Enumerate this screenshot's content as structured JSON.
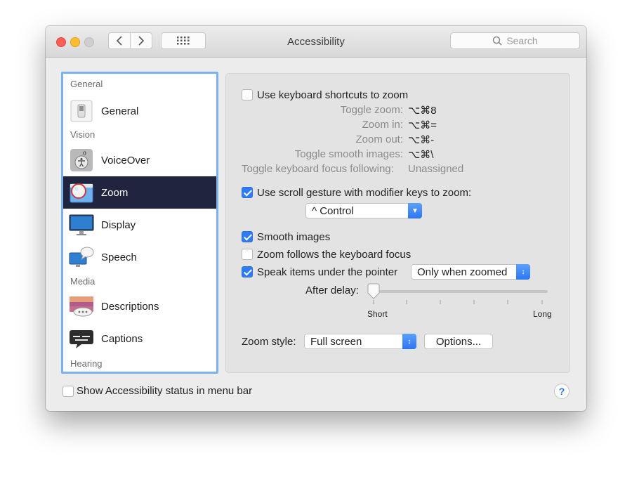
{
  "window": {
    "title": "Accessibility"
  },
  "toolbar": {
    "search_placeholder": "Search"
  },
  "sidebar": {
    "categories": [
      "General",
      "Vision",
      "Media",
      "Hearing"
    ],
    "items": [
      {
        "label": "General",
        "icon": "switch-icon"
      },
      {
        "label": "VoiceOver",
        "icon": "voiceover-icon"
      },
      {
        "label": "Zoom",
        "icon": "zoom-icon",
        "selected": true
      },
      {
        "label": "Display",
        "icon": "display-icon"
      },
      {
        "label": "Speech",
        "icon": "speech-icon"
      },
      {
        "label": "Descriptions",
        "icon": "descriptions-icon"
      },
      {
        "label": "Captions",
        "icon": "captions-icon"
      }
    ]
  },
  "zoom": {
    "keyboard_shortcuts": {
      "label": "Use keyboard shortcuts to zoom",
      "checked": false
    },
    "shortcuts": [
      {
        "label": "Toggle zoom:",
        "value": "⌥⌘8"
      },
      {
        "label": "Zoom in:",
        "value": "⌥⌘="
      },
      {
        "label": "Zoom out:",
        "value": "⌥⌘-"
      },
      {
        "label": "Toggle smooth images:",
        "value": "⌥⌘\\"
      },
      {
        "label": "Toggle keyboard focus following:",
        "value": "Unassigned"
      }
    ],
    "scroll_gesture": {
      "label": "Use scroll gesture with modifier keys to zoom:",
      "checked": true
    },
    "modifier_key": "^ Control",
    "smooth_images": {
      "label": "Smooth images",
      "checked": true
    },
    "follow_focus": {
      "label": "Zoom follows the keyboard focus",
      "checked": false
    },
    "speak_items": {
      "label": "Speak items under the pointer",
      "checked": true,
      "value": "Only when zoomed"
    },
    "delay": {
      "label": "After delay:",
      "min_label": "Short",
      "max_label": "Long",
      "value": 0
    },
    "zoom_style": {
      "label": "Zoom style:",
      "value": "Full screen",
      "options_label": "Options..."
    }
  },
  "footer": {
    "status_menu": {
      "label": "Show Accessibility status in menu bar",
      "checked": false
    },
    "help_label": "?"
  },
  "colors": {
    "accent": "#2f7bf5",
    "selection": "#20243f",
    "focus_ring": "#7ab1f1"
  }
}
